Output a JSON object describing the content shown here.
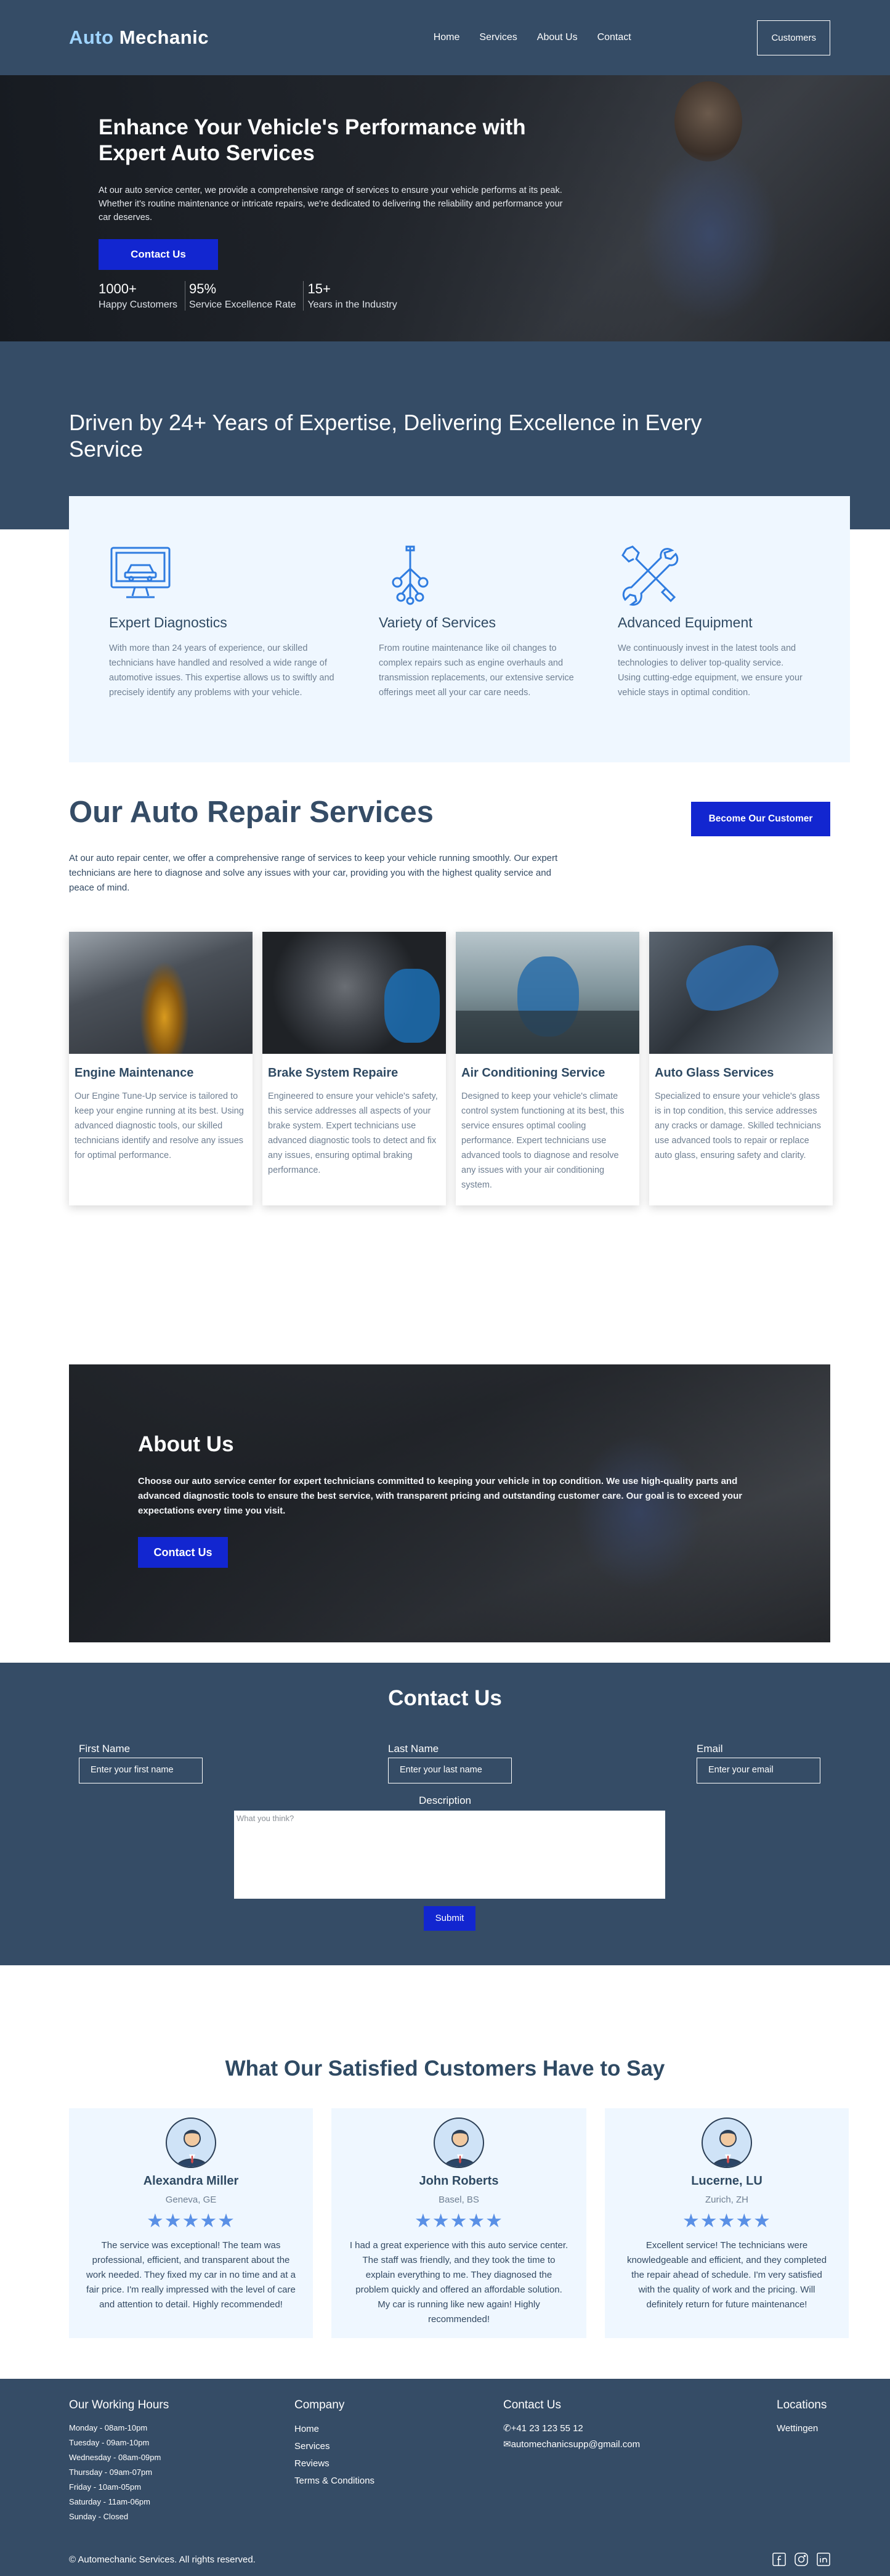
{
  "nav": {
    "logo_accent": "Auto",
    "logo_rest": " Mechanic",
    "links": [
      "Home",
      "Services",
      "About Us",
      "Contact"
    ],
    "cta": "Customers"
  },
  "hero": {
    "title": "Enhance Your Vehicle's Performance with Expert Auto Services",
    "text": "At our auto service center, we provide a comprehensive range of services to ensure your vehicle performs at its peak. Whether it's routine maintenance or intricate repairs, we're dedicated to delivering the reliability and performance your car deserves.",
    "button": "Contact Us",
    "stats": [
      {
        "num": "1000+",
        "label": "Happy Customers"
      },
      {
        "num": "95%",
        "label": "Service Excellence Rate"
      },
      {
        "num": "15+",
        "label": "Years in the Industry"
      }
    ]
  },
  "driven": {
    "title": "Driven by 24+ Years of Expertise, Delivering Excellence in Every Service",
    "features": [
      {
        "icon": "computer-diagnostics-icon",
        "title": "Expert Diagnostics",
        "text": "With more than 24 years of experience, our skilled technicians have handled and resolved a wide range of automotive issues. This expertise allows us to swiftly and precisely identify any problems with your vehicle."
      },
      {
        "icon": "car-parts-icon",
        "title": "Variety of Services",
        "text": "From routine maintenance like oil changes to complex repairs such as engine overhauls and transmission replacements, our extensive service offerings meet all your car care needs."
      },
      {
        "icon": "wrench-screwdriver-icon",
        "title": "Advanced Equipment",
        "text": "We continuously invest in the latest tools and technologies to deliver top-quality service. Using cutting-edge equipment, we ensure your vehicle stays in optimal condition."
      }
    ]
  },
  "services": {
    "title": "Our Auto Repair Services",
    "cta": "Become Our Customer",
    "intro": "At our auto repair center, we offer a comprehensive range of services to keep your vehicle running smoothly. Our expert technicians are here to diagnose and solve any issues with your car, providing you with the highest quality service and peace of mind.",
    "cards": [
      {
        "title": "Engine Maintenance",
        "text": "Our Engine Tune-Up service is tailored to keep your engine running at its best. Using advanced diagnostic tools, our skilled technicians identify and resolve any issues for optimal performance."
      },
      {
        "title": "Brake System Repaire",
        "text": "Engineered to ensure your vehicle's safety, this service addresses all aspects of your brake system. Expert technicians use advanced diagnostic tools to detect and fix any issues, ensuring optimal braking performance."
      },
      {
        "title": "Air Conditioning Service",
        "text": "Designed to keep your vehicle's climate control system functioning at its best, this service ensures optimal cooling performance. Expert technicians use advanced tools to diagnose and resolve any issues with your air conditioning system."
      },
      {
        "title": "Auto Glass Services",
        "text": "Specialized to ensure your vehicle's glass is in top condition, this service addresses any cracks or damage. Skilled technicians use advanced tools to repair or replace auto glass, ensuring safety and clarity."
      }
    ]
  },
  "about": {
    "title": "About Us",
    "text": "Choose our auto service center for expert technicians committed to keeping your vehicle in top condition. We use high-quality parts and advanced diagnostic tools to ensure the best service, with transparent pricing and outstanding customer care. Our goal is to exceed your expectations every time you visit.",
    "button": "Contact Us"
  },
  "contact": {
    "title": "Contact Us",
    "first_label": "First Name",
    "first_placeholder": "Enter your first name",
    "last_label": "Last Name",
    "last_placeholder": "Enter your last name",
    "email_label": "Email",
    "email_placeholder": "Enter your email",
    "desc_label": "Description",
    "desc_placeholder": "What you think?",
    "submit": "Submit"
  },
  "testimonials": {
    "title": "What Our Satisfied Customers Have to Say",
    "stars": "★★★★★",
    "items": [
      {
        "name": "Alexandra Miller",
        "loc": "Geneva, GE",
        "text": "The service was exceptional! The team was professional, efficient, and transparent about the work needed. They fixed my car in no time and at a fair price. I'm really impressed with the level of care and attention to detail. Highly recommended!"
      },
      {
        "name": "John Roberts",
        "loc": "Basel, BS",
        "text": "I had a great experience with this auto service center. The staff was friendly, and they took the time to explain everything to me. They diagnosed the problem quickly and offered an affordable solution. My car is running like new again! Highly recommended!"
      },
      {
        "name": "Lucerne, LU",
        "loc": "Zurich, ZH",
        "text": "Excellent service! The technicians were knowledgeable and efficient, and they completed the repair ahead of schedule. I'm very satisfied with the quality of work and the pricing. Will definitely return for future maintenance!"
      }
    ]
  },
  "footer": {
    "hours_title": "Our Working Hours",
    "hours": [
      "Monday - 08am-10pm",
      "Tuesday - 09am-10pm",
      "Wednesday - 08am-09pm",
      "Thursday - 09am-07pm",
      "Friday - 10am-05pm",
      "Saturday - 11am-06pm",
      "Sunday - Closed"
    ],
    "company_title": "Company",
    "company_links": [
      "Home",
      "Services",
      "Reviews",
      "Terms & Conditions"
    ],
    "contact_title": "Contact Us",
    "phone": "+41 23 123 55 12",
    "email": "automechanicsupp@gmail.com",
    "locations_title": "Locations",
    "location": "Wettingen",
    "copyright": "© Automechanic Services. All rights reserved.",
    "socials": [
      "facebook-icon",
      "instagram-icon",
      "linkedin-icon"
    ]
  }
}
